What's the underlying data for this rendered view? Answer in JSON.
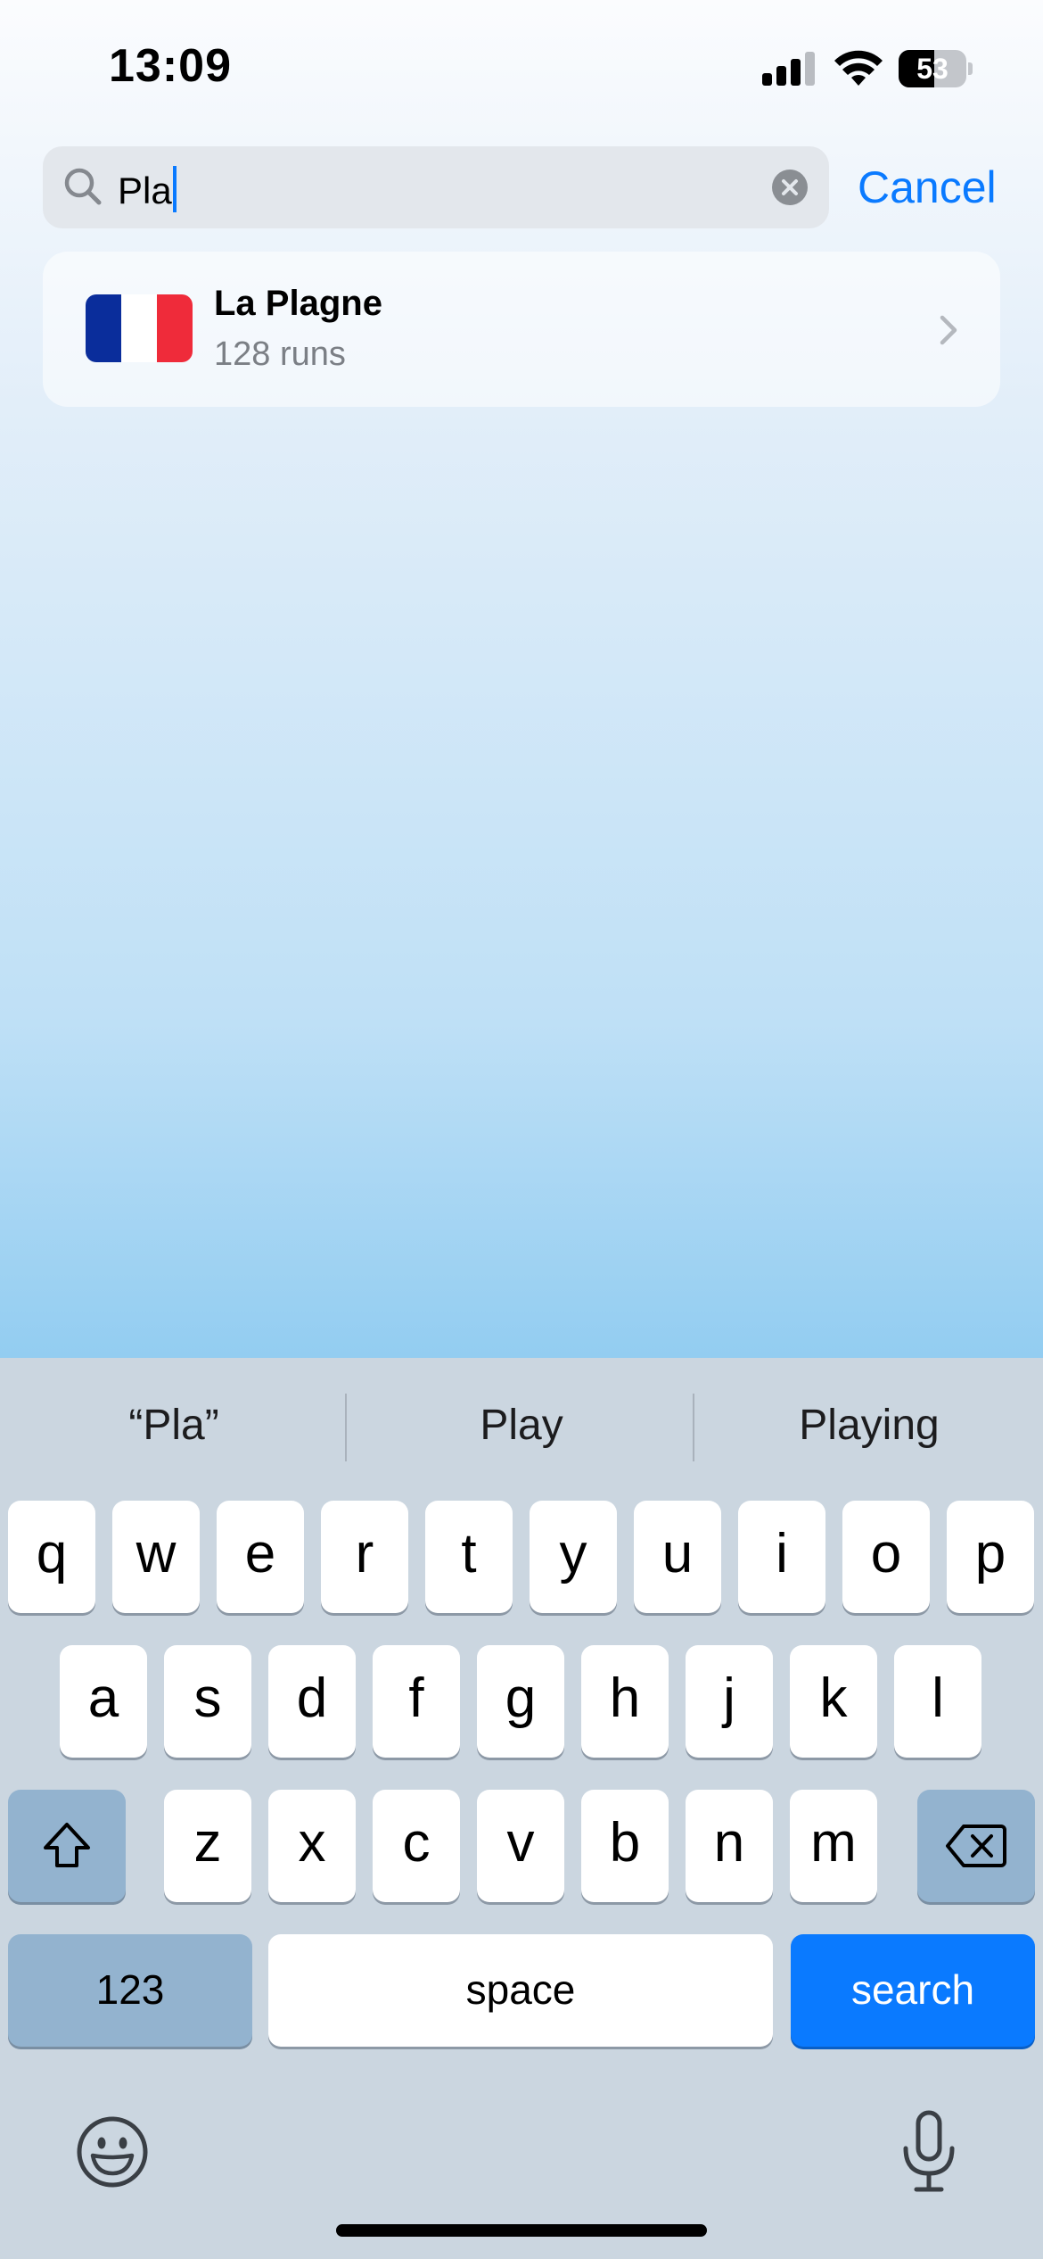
{
  "status_bar": {
    "time": "13:09",
    "battery_level": "53",
    "battery_fraction": 0.53,
    "signal_bars": 3
  },
  "search": {
    "query": "Pla",
    "cancel_label": "Cancel"
  },
  "results": [
    {
      "title": "La Plagne",
      "subtitle": "128 runs",
      "flag": "france-flag"
    }
  ],
  "keyboard": {
    "suggestions": [
      "“Pla”",
      "Play",
      "Playing"
    ],
    "rows": [
      [
        "q",
        "w",
        "e",
        "r",
        "t",
        "y",
        "u",
        "i",
        "o",
        "p"
      ],
      [
        "a",
        "s",
        "d",
        "f",
        "g",
        "h",
        "j",
        "k",
        "l"
      ],
      [
        "z",
        "x",
        "c",
        "v",
        "b",
        "n",
        "m"
      ]
    ],
    "numbers_label": "123",
    "space_label": "space",
    "search_label": "search"
  },
  "colors": {
    "accent": "#0a7aff",
    "keyboard_bg": "#cbd6e0",
    "flag_blue": "#0a2d9b",
    "flag_red": "#ef2b3a"
  }
}
